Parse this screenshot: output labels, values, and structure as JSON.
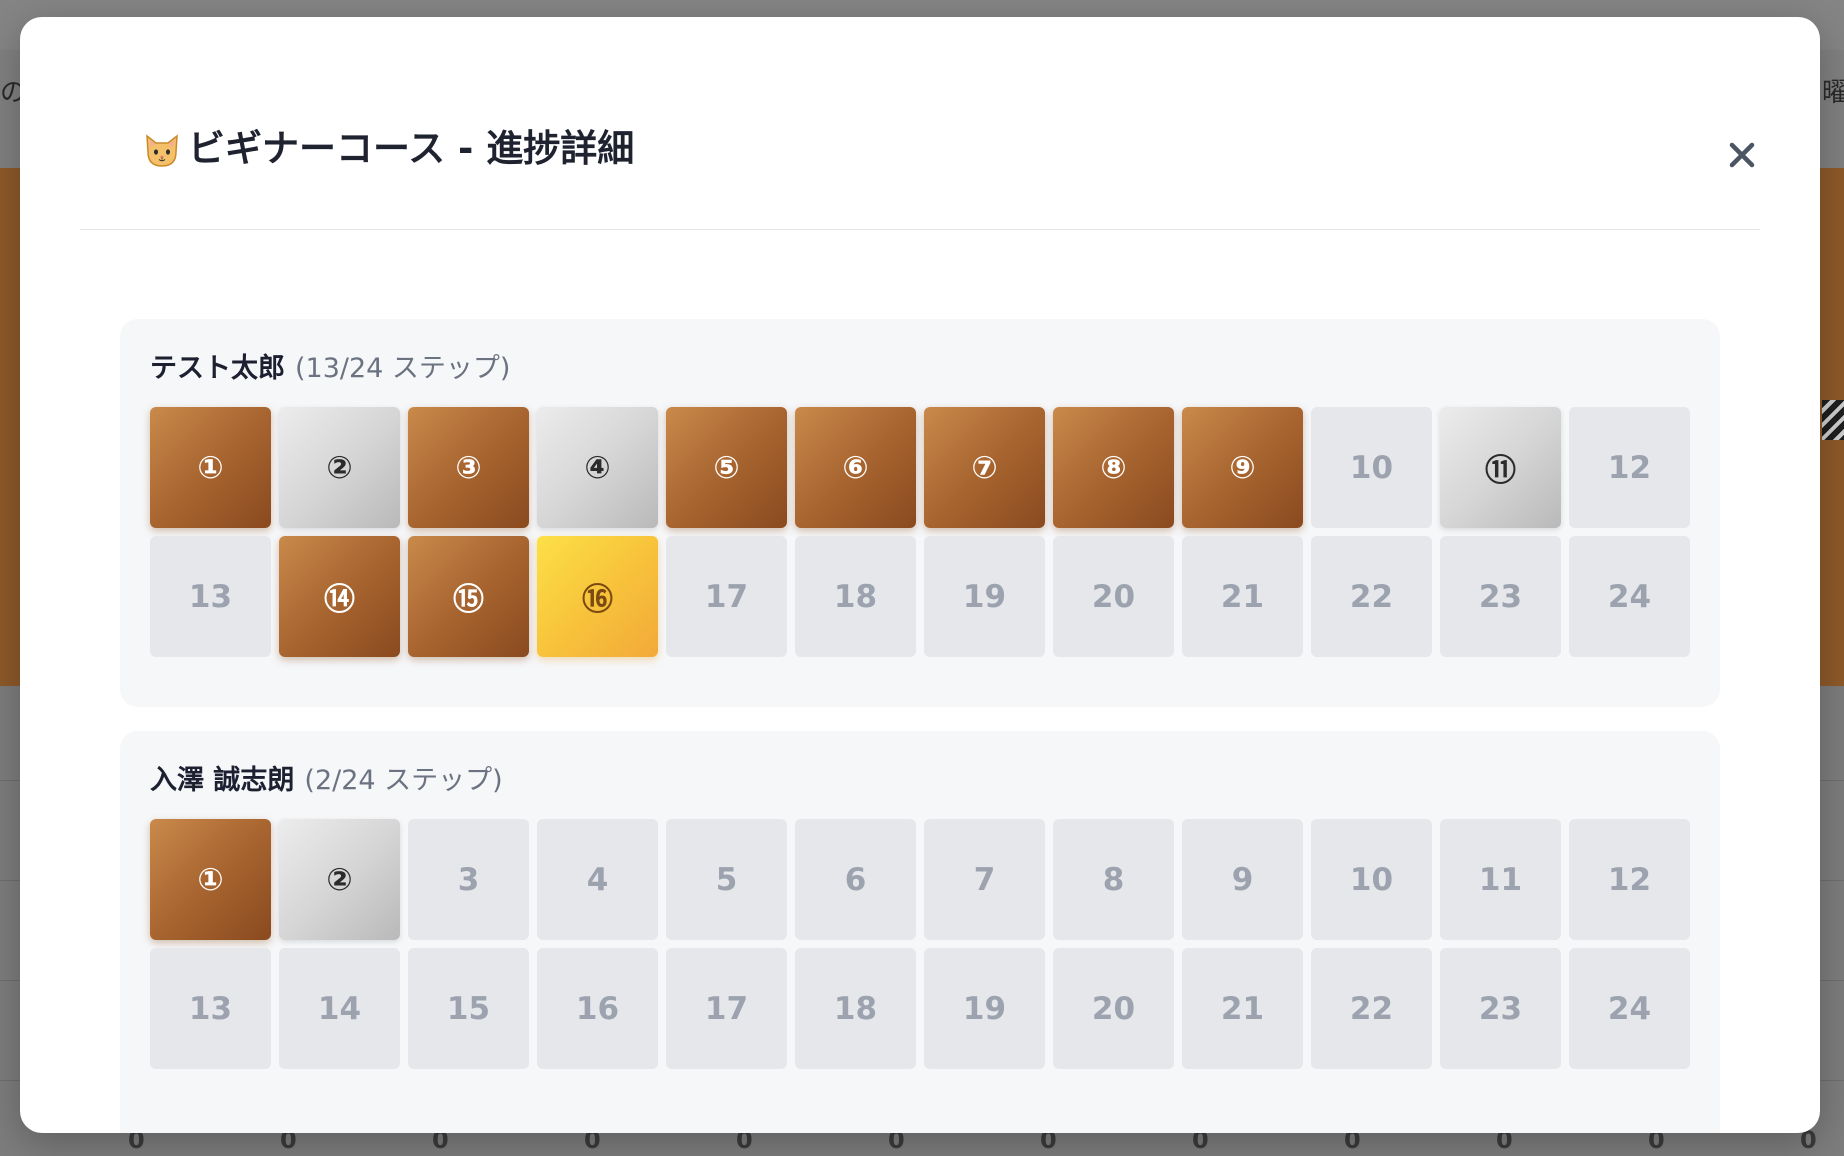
{
  "background": {
    "left_text": "の",
    "right_text": "曜",
    "zeros": [
      "0",
      "0",
      "0",
      "0",
      "0",
      "0",
      "0",
      "0",
      "0",
      "0",
      "0",
      "0"
    ]
  },
  "modal": {
    "icon": "cat-face-icon",
    "title": "ビギナーコース - 進捗詳細",
    "close_label": "×"
  },
  "students": [
    {
      "name": "テスト太郎",
      "progress_text": "(13/24 ステップ)",
      "steps": [
        {
          "label": "①",
          "status": "done"
        },
        {
          "label": "②",
          "status": "partial"
        },
        {
          "label": "③",
          "status": "done"
        },
        {
          "label": "④",
          "status": "partial"
        },
        {
          "label": "⑤",
          "status": "done"
        },
        {
          "label": "⑥",
          "status": "done"
        },
        {
          "label": "⑦",
          "status": "done"
        },
        {
          "label": "⑧",
          "status": "done"
        },
        {
          "label": "⑨",
          "status": "done"
        },
        {
          "label": "10",
          "status": "pending"
        },
        {
          "label": "⑪",
          "status": "partial"
        },
        {
          "label": "12",
          "status": "pending"
        },
        {
          "label": "13",
          "status": "pending"
        },
        {
          "label": "⑭",
          "status": "done"
        },
        {
          "label": "⑮",
          "status": "done"
        },
        {
          "label": "⑯",
          "status": "current"
        },
        {
          "label": "17",
          "status": "pending"
        },
        {
          "label": "18",
          "status": "pending"
        },
        {
          "label": "19",
          "status": "pending"
        },
        {
          "label": "20",
          "status": "pending"
        },
        {
          "label": "21",
          "status": "pending"
        },
        {
          "label": "22",
          "status": "pending"
        },
        {
          "label": "23",
          "status": "pending"
        },
        {
          "label": "24",
          "status": "pending"
        }
      ]
    },
    {
      "name": "入澤 誠志朗",
      "progress_text": "(2/24 ステップ)",
      "steps": [
        {
          "label": "①",
          "status": "done"
        },
        {
          "label": "②",
          "status": "partial"
        },
        {
          "label": "3",
          "status": "pending"
        },
        {
          "label": "4",
          "status": "pending"
        },
        {
          "label": "5",
          "status": "pending"
        },
        {
          "label": "6",
          "status": "pending"
        },
        {
          "label": "7",
          "status": "pending"
        },
        {
          "label": "8",
          "status": "pending"
        },
        {
          "label": "9",
          "status": "pending"
        },
        {
          "label": "10",
          "status": "pending"
        },
        {
          "label": "11",
          "status": "pending"
        },
        {
          "label": "12",
          "status": "pending"
        },
        {
          "label": "13",
          "status": "pending"
        },
        {
          "label": "14",
          "status": "pending"
        },
        {
          "label": "15",
          "status": "pending"
        },
        {
          "label": "16",
          "status": "pending"
        },
        {
          "label": "17",
          "status": "pending"
        },
        {
          "label": "18",
          "status": "pending"
        },
        {
          "label": "19",
          "status": "pending"
        },
        {
          "label": "20",
          "status": "pending"
        },
        {
          "label": "21",
          "status": "pending"
        },
        {
          "label": "22",
          "status": "pending"
        },
        {
          "label": "23",
          "status": "pending"
        },
        {
          "label": "24",
          "status": "pending"
        }
      ]
    }
  ]
}
